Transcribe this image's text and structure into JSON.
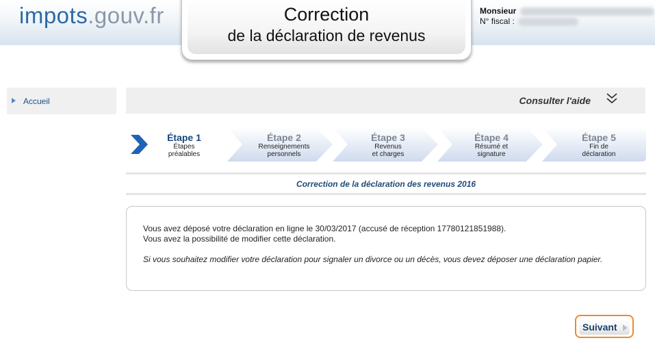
{
  "header": {
    "logo_part1": "impots",
    "logo_part2": ".gouv.fr",
    "title_line1": "Correction",
    "title_line2": "de la déclaration de revenus",
    "user_label": "Monsieur",
    "fiscal_label": "N° fiscal :"
  },
  "sidebar": {
    "items": [
      {
        "label": "Accueil"
      }
    ]
  },
  "help": {
    "label": "Consulter l'aide",
    "icon": "double-chevron-down-icon"
  },
  "steps": [
    {
      "title": "Étape 1",
      "line1": "Étapes",
      "line2": "préalables",
      "active": true
    },
    {
      "title": "Étape 2",
      "line1": "Renseignements",
      "line2": "personnels",
      "active": false
    },
    {
      "title": "Étape 3",
      "line1": "Revenus",
      "line2": "et charges",
      "active": false
    },
    {
      "title": "Étape 4",
      "line1": "Résumé et",
      "line2": "signature",
      "active": false
    },
    {
      "title": "Étape 5",
      "line1": "Fin de",
      "line2": "déclaration",
      "active": false
    }
  ],
  "subtitle": "Correction de la déclaration des revenus 2016",
  "message": {
    "line1": "Vous avez déposé votre déclaration en ligne le 30/03/2017 (accusé de réception 17780121851988).",
    "line2": "Vous avez la possibilité de modifier cette déclaration.",
    "line3": "Si vous souhaitez modifier votre déclaration pour signaler un divorce ou un décès, vous devez déposer une déclaration papier."
  },
  "next_button": {
    "label": "Suivant"
  },
  "colors": {
    "accent_blue": "#1f4a78",
    "logo_blue": "#2b6aa8",
    "next_border": "#e98b2f",
    "step_fill": "#dfe7f3"
  }
}
